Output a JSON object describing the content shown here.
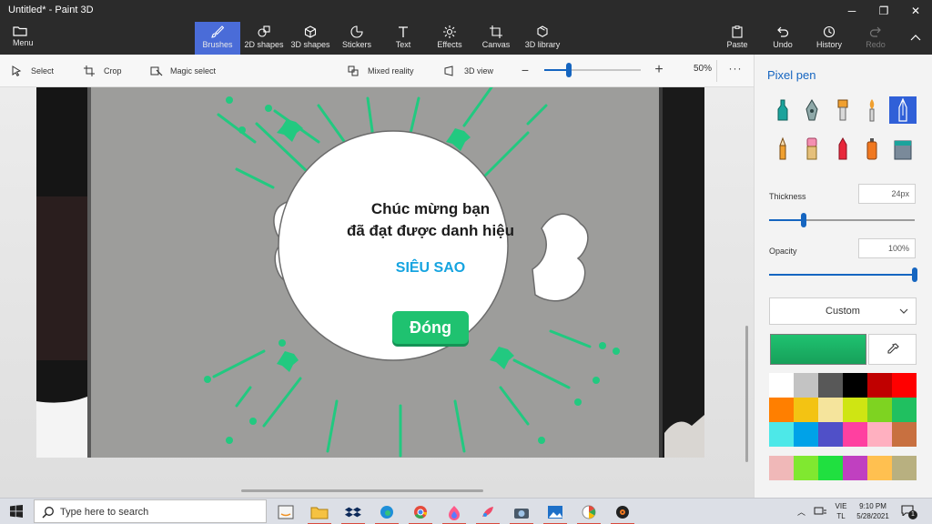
{
  "window": {
    "title": "Untitled* - Paint 3D",
    "controls": {
      "minimize": "─",
      "maximize": "❐",
      "close": "✕"
    }
  },
  "ribbon": {
    "menu": "Menu",
    "tabs": [
      {
        "label": "Brushes",
        "icon": "brush-icon",
        "active": true
      },
      {
        "label": "2D shapes",
        "icon": "2d-shapes-icon"
      },
      {
        "label": "3D shapes",
        "icon": "3d-shapes-icon"
      },
      {
        "label": "Stickers",
        "icon": "stickers-icon"
      },
      {
        "label": "Text",
        "icon": "text-icon"
      },
      {
        "label": "Effects",
        "icon": "effects-icon"
      },
      {
        "label": "Canvas",
        "icon": "canvas-icon"
      },
      {
        "label": "3D library",
        "icon": "3d-library-icon"
      }
    ],
    "actions": [
      {
        "label": "Paste",
        "icon": "paste-icon"
      },
      {
        "label": "Undo",
        "icon": "undo-icon"
      },
      {
        "label": "History",
        "icon": "history-icon"
      },
      {
        "label": "Redo",
        "icon": "redo-icon",
        "disabled": true
      }
    ]
  },
  "toolbar": {
    "select": "Select",
    "crop": "Crop",
    "magic_select": "Magic select",
    "mixed_reality": "Mixed reality",
    "view_3d": "3D view",
    "zoom_minus": "−",
    "zoom_plus": "+",
    "zoom_value": "50%",
    "zoom_fraction": 0.25,
    "more": "···"
  },
  "popup": {
    "title_line1": "Chúc mừng bạn",
    "title_line2": "đã đạt được danh hiệu",
    "subtitle": "SIÊU SAO",
    "close_button": "Đóng"
  },
  "side_panel": {
    "title": "Pixel pen",
    "tools": [
      "marker-icon",
      "calligraphy-pen-icon",
      "oil-brush-icon",
      "watercolor-icon",
      "pixel-pen-icon",
      "pencil-icon",
      "eraser-icon",
      "crayon-icon",
      "spray-can-icon",
      "fill-bucket-icon"
    ],
    "thickness_label": "Thickness",
    "thickness_value": "24px",
    "thickness_fraction": 0.24,
    "opacity_label": "Opacity",
    "opacity_value": "100%",
    "opacity_fraction": 1.0,
    "color_dropdown": "Custom",
    "current_color": "#1fc270",
    "palette": [
      "#ffffff",
      "#c3c3c3",
      "#585858",
      "#000000",
      "#c00000",
      "#ff0000",
      "#ff7f00",
      "#f3c313",
      "#f5e49c",
      "#cfe513",
      "#7ed321",
      "#20c060",
      "#4de8e8",
      "#00a2e8",
      "#5050c8",
      "#ff40a0",
      "#ffb0c0",
      "#c87040"
    ],
    "custom_palette": [
      "#f0b8b8",
      "#80e830",
      "#20e040",
      "#c040c0",
      "#ffc050",
      "#b8b080"
    ]
  },
  "taskbar": {
    "search_placeholder": "Type here to search",
    "apps": [
      {
        "icon": "amazon-icon",
        "running": false
      },
      {
        "icon": "file-explorer-icon",
        "running": true
      },
      {
        "icon": "dropbox-icon",
        "running": true
      },
      {
        "icon": "edge-icon",
        "running": true
      },
      {
        "icon": "chrome-icon",
        "running": true
      },
      {
        "icon": "flame-app-icon",
        "running": true
      },
      {
        "icon": "paint-3d-icon",
        "running": true
      },
      {
        "icon": "camera-icon",
        "running": true
      },
      {
        "icon": "photos-icon",
        "running": true
      },
      {
        "icon": "color-app-icon",
        "running": true
      },
      {
        "icon": "media-player-icon",
        "running": true
      }
    ],
    "tray_chevron": "︿",
    "lang_line1": "VIE",
    "lang_line2": "TL",
    "time": "9:10 PM",
    "date": "5/28/2021",
    "notification_count": "1"
  }
}
